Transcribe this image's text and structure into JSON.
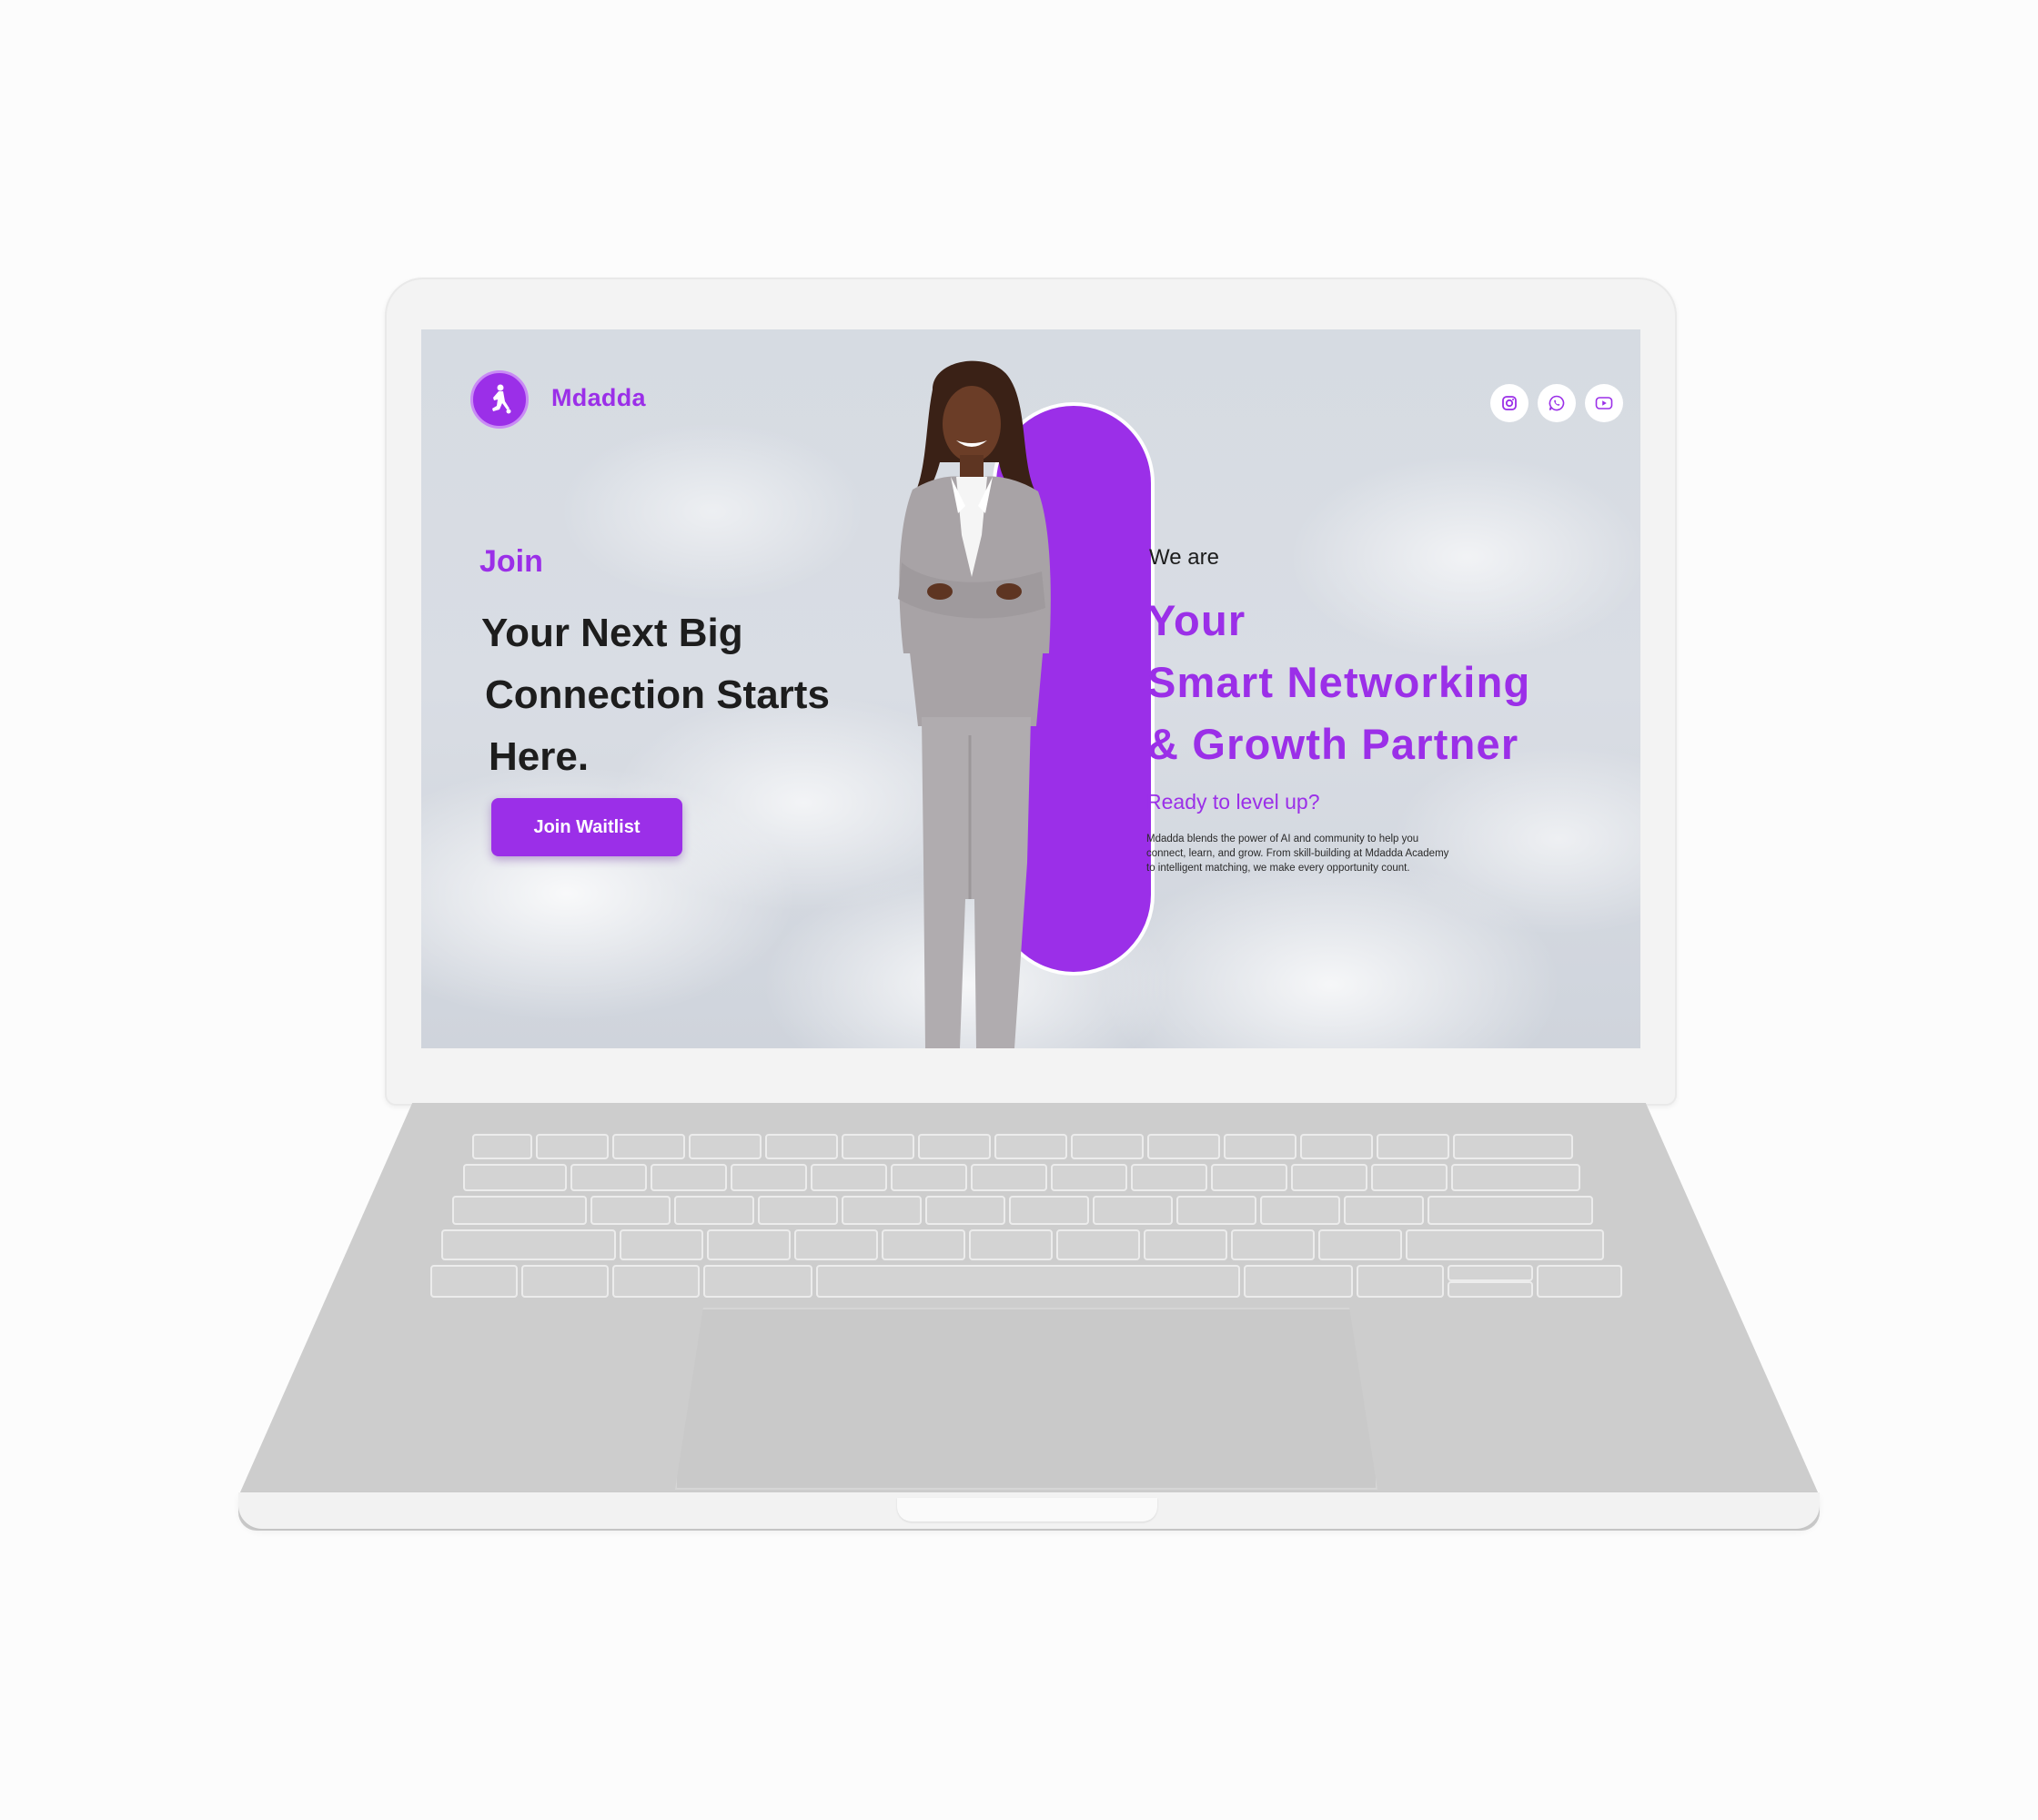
{
  "site": {
    "brand": "Mdadda",
    "social": [
      {
        "icon": "instagram-icon"
      },
      {
        "icon": "whatsapp-icon"
      },
      {
        "icon": "youtube-icon"
      }
    ],
    "hero_left": {
      "eyebrow": "Join",
      "headline_lines": [
        "Your Next Big",
        "Connection Starts",
        "Here."
      ],
      "cta_label": "Join Waitlist"
    },
    "hero_right": {
      "intro": "We are",
      "tagline_lines": [
        "Your",
        "Smart Networking",
        "& Growth Partner"
      ],
      "subheading": "Ready to level up?",
      "description": "Mdadda blends the power of AI and community to help you connect, learn, and grow. From skill-building at Mdadda Academy to intelligent matching, we make every opportunity count."
    }
  },
  "colors": {
    "accent": "#9b2fe8",
    "text_dark": "#1d1d1d",
    "sky": "#d6dbe2",
    "laptop_body": "#cdcdcd"
  }
}
